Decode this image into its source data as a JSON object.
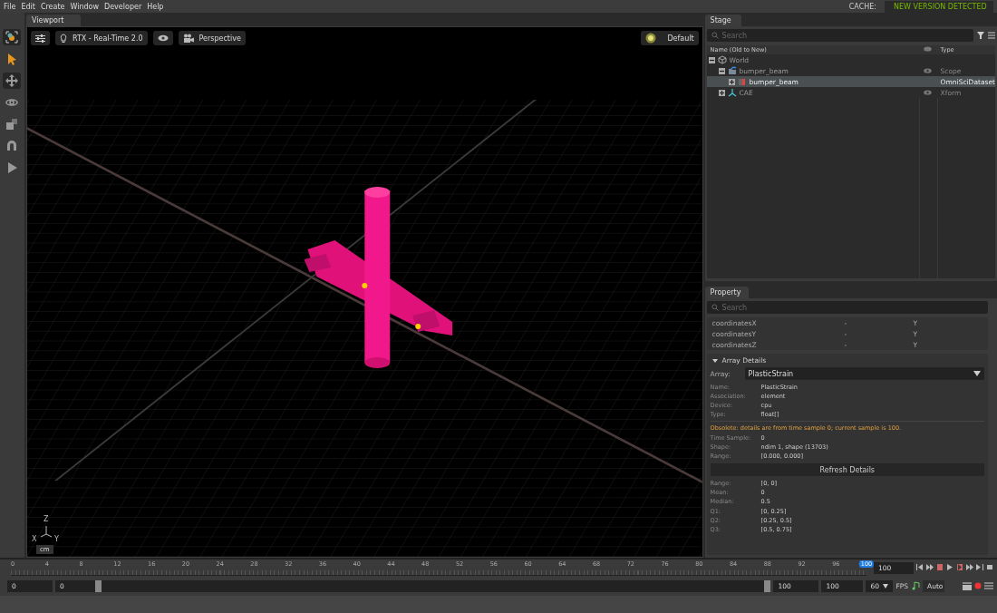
{
  "menu": [
    "File",
    "Edit",
    "Create",
    "Window",
    "Developer",
    "Help"
  ],
  "cache": {
    "label": "CACHE:",
    "status": "NEW VERSION DETECTED"
  },
  "tools": [
    {
      "kind": "frame",
      "selected": false
    },
    {
      "kind": "select",
      "selected": true
    },
    {
      "kind": "move",
      "selected": false
    },
    {
      "kind": "rotate",
      "selected": false
    },
    {
      "kind": "scale",
      "selected": false
    },
    {
      "kind": "snap",
      "selected": false
    },
    {
      "kind": "play",
      "selected": false
    }
  ],
  "viewport": {
    "tab": "Viewport",
    "renderer": "RTX - Real-Time 2.0",
    "camera": "Perspective",
    "lighting": "Default",
    "units": "cm",
    "axes": [
      "Z",
      "X",
      "Y"
    ]
  },
  "stage": {
    "tab": "Stage",
    "search": {
      "placeholder": "Search"
    },
    "columns": [
      "Name (Old to New)",
      "Type"
    ],
    "tree": [
      {
        "name": "World",
        "expanded": true,
        "eye": false,
        "selected": false,
        "kind": "xform",
        "children": [
          {
            "name": "bumper_beam",
            "type": "Scope",
            "expanded": true,
            "eye": true,
            "selected": false,
            "kind": "scope",
            "children": [
              {
                "name": "bumper_beam",
                "type": "OmniSciDataset",
                "expanded": false,
                "eye": false,
                "selected": true,
                "kind": "mesh"
              }
            ]
          },
          {
            "name": "CAE",
            "type": "Xform",
            "expanded": false,
            "eye": true,
            "selected": false,
            "kind": "axes"
          }
        ]
      }
    ]
  },
  "property": {
    "tab": "Property",
    "search": {
      "placeholder": "Search"
    },
    "rows": [
      [
        "coordinatesX",
        "-",
        "Y"
      ],
      [
        "coordinatesY",
        "-",
        "Y"
      ],
      [
        "coordinatesZ",
        "-",
        "Y"
      ]
    ],
    "section": {
      "title": "Array Details",
      "expanded": true,
      "array_label": "Array:",
      "array_value": "PlasticStrain",
      "info": [
        [
          "Name:",
          "PlasticStrain"
        ],
        [
          "Association:",
          "element"
        ],
        [
          "Device:",
          "cpu"
        ],
        [
          "Type:",
          "float[]"
        ]
      ],
      "warning": "Obsolete: details are from time sample 0; current sample is 100.",
      "sample": [
        [
          "Time Sample:",
          "0"
        ],
        [
          "Shape:",
          "ndim 1, shape (13703)"
        ],
        [
          "Range:",
          "[0.000, 0.000]"
        ]
      ],
      "refresh": "Refresh Details",
      "stats": [
        [
          "Range:",
          "[0, 0]"
        ],
        [
          "Mean:",
          "0"
        ],
        [
          "Median:",
          "0.5"
        ]
      ],
      "quartiles": [
        [
          "Q1:",
          "[0, 0.25]"
        ],
        [
          "Q2:",
          "[0.25, 0.5]"
        ],
        [
          "Q3:",
          "[0.5, 0.75]"
        ]
      ]
    }
  },
  "timeline": {
    "ticks": [
      "0",
      "4",
      "8",
      "12",
      "16",
      "20",
      "24",
      "28",
      "32",
      "36",
      "40",
      "44",
      "48",
      "52",
      "56",
      "60",
      "64",
      "68",
      "72",
      "76",
      "80",
      "84",
      "88",
      "92",
      "96"
    ],
    "playhead": "100",
    "level": 1,
    "current": "100",
    "start": "0",
    "range_slider": {
      "value": "0",
      "level": 1
    },
    "range_end": "100",
    "end": "100",
    "fps": "60",
    "fps_label": "FPS",
    "mode": "Auto"
  }
}
